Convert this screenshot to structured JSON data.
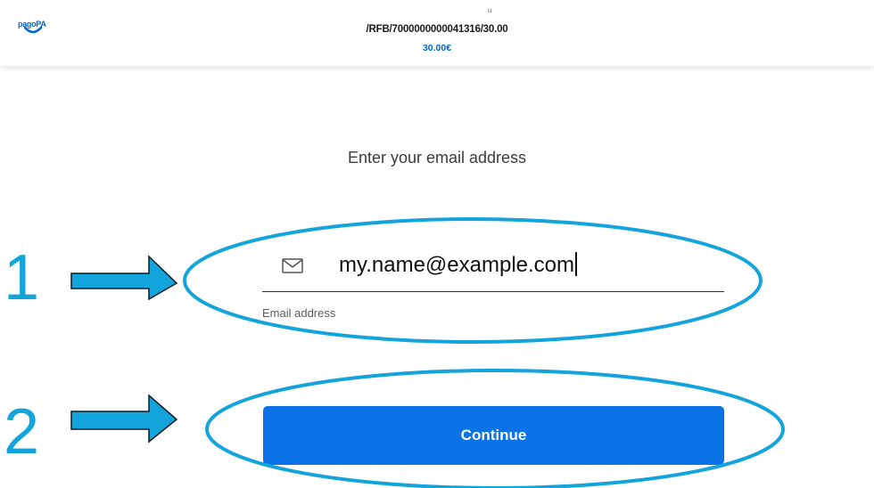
{
  "header": {
    "logo_text": "pagoPA",
    "small_mark": "u",
    "reference": "/RFB/7000000000041316/30.00",
    "amount": "30.00€"
  },
  "main": {
    "prompt": "Enter your email address",
    "email_value": "my.name@example.com",
    "email_label": "Email address",
    "continue_label": "Continue"
  },
  "annotations": {
    "step_1": "1",
    "step_2": "2"
  },
  "colors": {
    "brand_blue": "#0066cc",
    "button_blue": "#0b73e6",
    "annotation_cyan": "#14a4dc"
  },
  "icons": {
    "email_field": "envelope-icon",
    "logo": "pagopa-logo"
  }
}
